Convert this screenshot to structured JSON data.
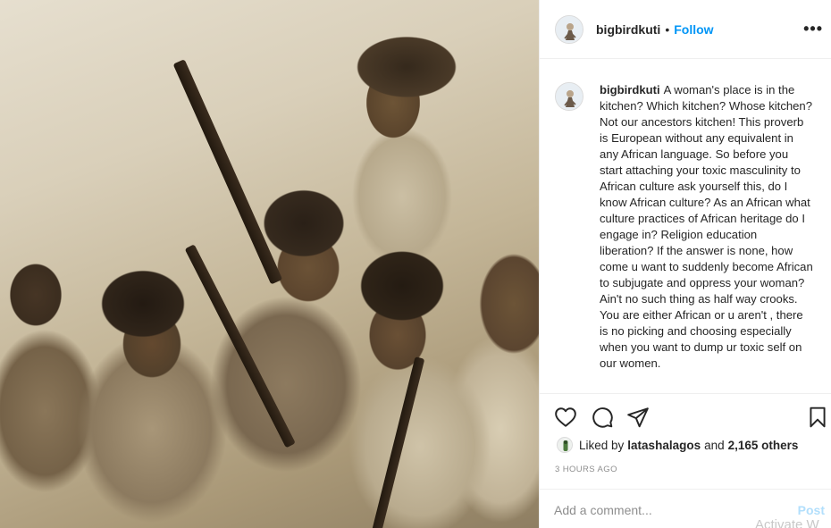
{
  "post": {
    "username": "bigbirdkuti",
    "separator": "•",
    "follow_label": "Follow",
    "more_icon": "more-horizontal-icon",
    "more_label": "•••"
  },
  "caption": {
    "username": "bigbirdkuti",
    "text": "A woman's place is in the kitchen? Which kitchen? Whose kitchen? Not our ancestors kitchen! This proverb is European without any equivalent in any African language. So before you start attaching your toxic masculinity to African culture ask yourself this, do I know African culture? As an African what culture practices of African heritage do I engage in? Religion education liberation? If the answer is none, how come u want to suddenly become African to subjugate and oppress your woman? Ain't no such thing as half way crooks. You are either African or u aren't , there is no picking and choosing especially when you want to dump ur toxic self on our women."
  },
  "actions": {
    "like_icon": "heart-icon",
    "comment_icon": "comment-bubble-icon",
    "share_icon": "paper-plane-icon",
    "save_icon": "bookmark-icon"
  },
  "likes": {
    "prefix": "Liked by",
    "user": "latashalagos",
    "conjunction": "and",
    "others": "2,165 others"
  },
  "timestamp": "3 HOURS AGO",
  "comment": {
    "placeholder": "Add a comment...",
    "post_label": "Post"
  },
  "watermark": "Activate W",
  "colors": {
    "accent": "#0095f6",
    "post_disabled": "#b2dffc",
    "text": "#262626",
    "muted": "#8e8e8e",
    "border": "#efefef"
  }
}
